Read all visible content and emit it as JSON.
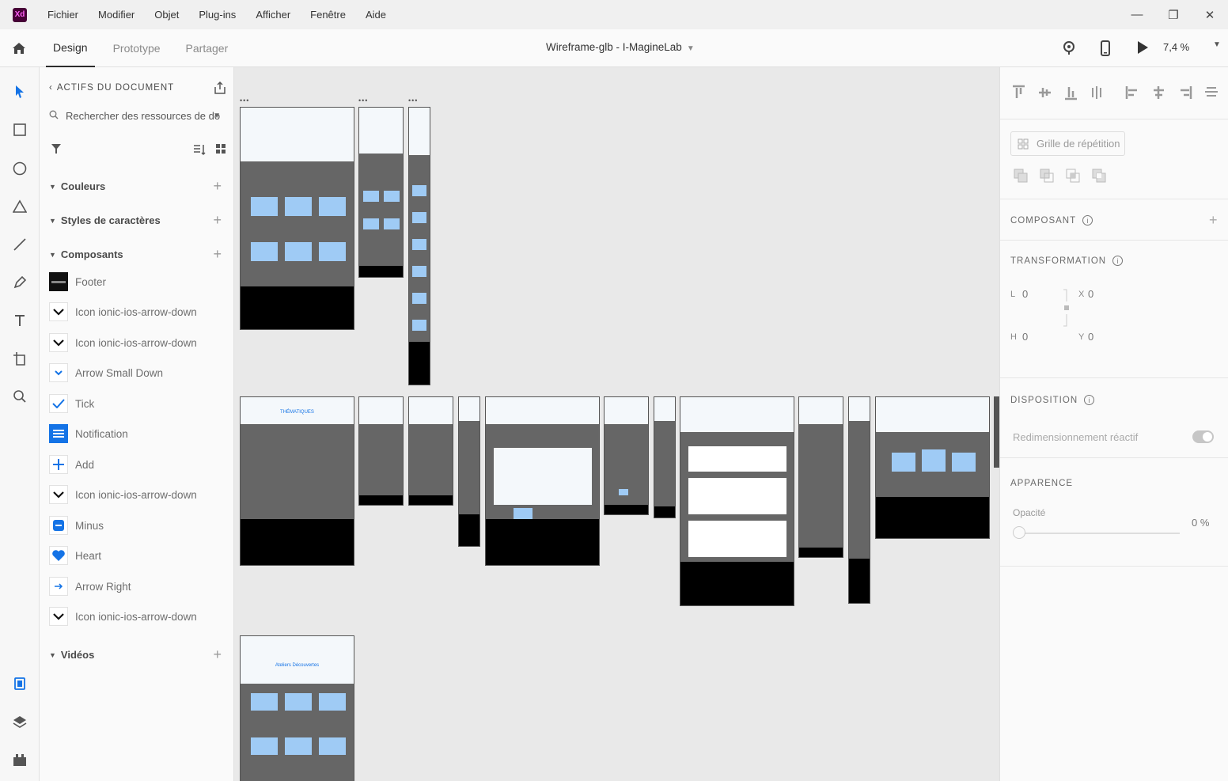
{
  "app": {
    "logo": "Xd"
  },
  "menu": [
    "Fichier",
    "Modifier",
    "Objet",
    "Plug-ins",
    "Afficher",
    "Fenêtre",
    "Aide"
  ],
  "window_controls": {
    "minimize": "—",
    "restore": "❐",
    "close": "✕"
  },
  "toolbar": {
    "tabs": [
      {
        "label": "Design",
        "active": true
      },
      {
        "label": "Prototype",
        "active": false
      },
      {
        "label": "Partager",
        "active": false
      }
    ],
    "doc_title": "Wireframe-glb - I-MagineLab",
    "zoom": "7,4 %"
  },
  "tools": [
    "select-icon",
    "rectangle-icon",
    "ellipse-icon",
    "polygon-icon",
    "line-icon",
    "pen-icon",
    "text-icon",
    "artboard-icon",
    "zoom-icon",
    "document-assets-icon",
    "layers-icon",
    "plugins-icon"
  ],
  "assets": {
    "header": "ACTIFS DU DOCUMENT",
    "search_placeholder": "Rechercher des ressources de do",
    "sections": {
      "colors": "Couleurs",
      "char_styles": "Styles de caractères",
      "components": "Composants",
      "videos": "Vidéos"
    },
    "components": [
      {
        "label": "Footer",
        "icon": "footer-thumb"
      },
      {
        "label": "Icon ionic-ios-arrow-down",
        "icon": "chevron-down-icon"
      },
      {
        "label": "Icon ionic-ios-arrow-down",
        "icon": "chevron-down-icon"
      },
      {
        "label": "Arrow Small Down",
        "icon": "arrow-small-down-icon"
      },
      {
        "label": "Tick",
        "icon": "tick-icon"
      },
      {
        "label": "Notification",
        "icon": "notification-icon"
      },
      {
        "label": "Add",
        "icon": "add-icon"
      },
      {
        "label": "Icon ionic-ios-arrow-down",
        "icon": "chevron-down-icon"
      },
      {
        "label": "Minus",
        "icon": "minus-icon"
      },
      {
        "label": "Heart",
        "icon": "heart-icon"
      },
      {
        "label": "Arrow Right",
        "icon": "arrow-right-icon"
      },
      {
        "label": "Icon ionic-ios-arrow-down",
        "icon": "chevron-down-icon"
      }
    ]
  },
  "canvas": {
    "artboard_titles": [
      "THÉMATIQUES",
      "Ateliers Découvertes"
    ]
  },
  "props": {
    "repeat_grid": "Grille de répétition",
    "component": "COMPOSANT",
    "transformation": "TRANSFORMATION",
    "w_label": "L",
    "w_value": "0",
    "x_label": "X",
    "x_value": "0",
    "h_label": "H",
    "h_value": "0",
    "y_label": "Y",
    "y_value": "0",
    "layout": "DISPOSITION",
    "responsive_resize": "Redimensionnement réactif",
    "appearance": "APPARENCE",
    "opacity_label": "Opacité",
    "opacity_value": "0 %"
  },
  "colors": {
    "accent": "#1473e6",
    "xd_brand": "#470137",
    "card_blue": "#9fcbf5"
  }
}
